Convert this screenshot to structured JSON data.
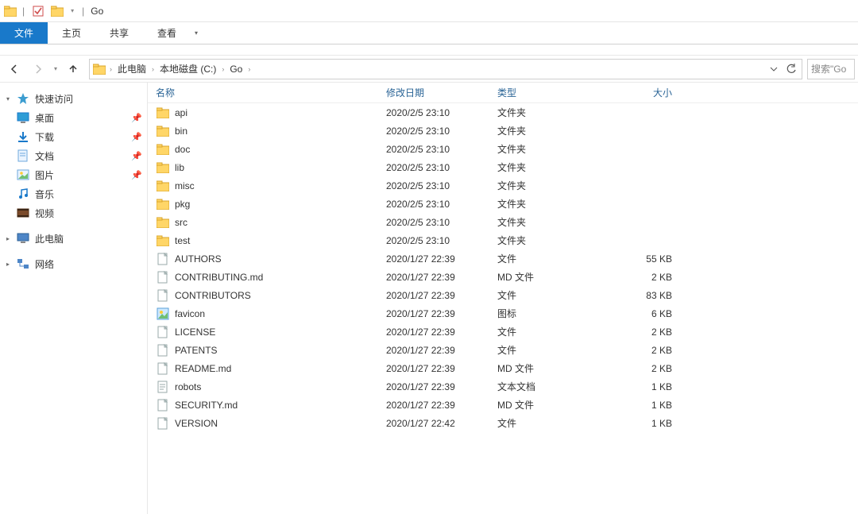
{
  "window": {
    "title": "Go"
  },
  "ribbon": {
    "tabs": [
      {
        "label": "文件",
        "active": true
      },
      {
        "label": "主页",
        "active": false
      },
      {
        "label": "共享",
        "active": false
      },
      {
        "label": "查看",
        "active": false
      }
    ]
  },
  "breadcrumb": {
    "parts": [
      "此电脑",
      "本地磁盘 (C:)",
      "Go"
    ]
  },
  "search": {
    "placeholder": "搜索\"Go"
  },
  "sidebar": {
    "quick_access": {
      "label": "快速访问",
      "items": [
        {
          "label": "桌面",
          "icon": "desktop",
          "pinned": true
        },
        {
          "label": "下载",
          "icon": "download",
          "pinned": true
        },
        {
          "label": "文档",
          "icon": "document",
          "pinned": true
        },
        {
          "label": "图片",
          "icon": "pictures",
          "pinned": true
        },
        {
          "label": "音乐",
          "icon": "music",
          "pinned": false
        },
        {
          "label": "视频",
          "icon": "video",
          "pinned": false
        }
      ]
    },
    "this_pc": {
      "label": "此电脑",
      "selected": true
    },
    "network": {
      "label": "网络"
    }
  },
  "columns": {
    "name": "名称",
    "date": "修改日期",
    "type": "类型",
    "size": "大小"
  },
  "files": [
    {
      "name": "api",
      "date": "2020/2/5 23:10",
      "type": "文件夹",
      "size": "",
      "icon": "folder"
    },
    {
      "name": "bin",
      "date": "2020/2/5 23:10",
      "type": "文件夹",
      "size": "",
      "icon": "folder"
    },
    {
      "name": "doc",
      "date": "2020/2/5 23:10",
      "type": "文件夹",
      "size": "",
      "icon": "folder"
    },
    {
      "name": "lib",
      "date": "2020/2/5 23:10",
      "type": "文件夹",
      "size": "",
      "icon": "folder"
    },
    {
      "name": "misc",
      "date": "2020/2/5 23:10",
      "type": "文件夹",
      "size": "",
      "icon": "folder"
    },
    {
      "name": "pkg",
      "date": "2020/2/5 23:10",
      "type": "文件夹",
      "size": "",
      "icon": "folder"
    },
    {
      "name": "src",
      "date": "2020/2/5 23:10",
      "type": "文件夹",
      "size": "",
      "icon": "folder"
    },
    {
      "name": "test",
      "date": "2020/2/5 23:10",
      "type": "文件夹",
      "size": "",
      "icon": "folder"
    },
    {
      "name": "AUTHORS",
      "date": "2020/1/27 22:39",
      "type": "文件",
      "size": "55 KB",
      "icon": "file"
    },
    {
      "name": "CONTRIBUTING.md",
      "date": "2020/1/27 22:39",
      "type": "MD 文件",
      "size": "2 KB",
      "icon": "file"
    },
    {
      "name": "CONTRIBUTORS",
      "date": "2020/1/27 22:39",
      "type": "文件",
      "size": "83 KB",
      "icon": "file"
    },
    {
      "name": "favicon",
      "date": "2020/1/27 22:39",
      "type": "图标",
      "size": "6 KB",
      "icon": "ico"
    },
    {
      "name": "LICENSE",
      "date": "2020/1/27 22:39",
      "type": "文件",
      "size": "2 KB",
      "icon": "file"
    },
    {
      "name": "PATENTS",
      "date": "2020/1/27 22:39",
      "type": "文件",
      "size": "2 KB",
      "icon": "file"
    },
    {
      "name": "README.md",
      "date": "2020/1/27 22:39",
      "type": "MD 文件",
      "size": "2 KB",
      "icon": "file"
    },
    {
      "name": "robots",
      "date": "2020/1/27 22:39",
      "type": "文本文档",
      "size": "1 KB",
      "icon": "txt"
    },
    {
      "name": "SECURITY.md",
      "date": "2020/1/27 22:39",
      "type": "MD 文件",
      "size": "1 KB",
      "icon": "file"
    },
    {
      "name": "VERSION",
      "date": "2020/1/27 22:42",
      "type": "文件",
      "size": "1 KB",
      "icon": "file"
    }
  ]
}
